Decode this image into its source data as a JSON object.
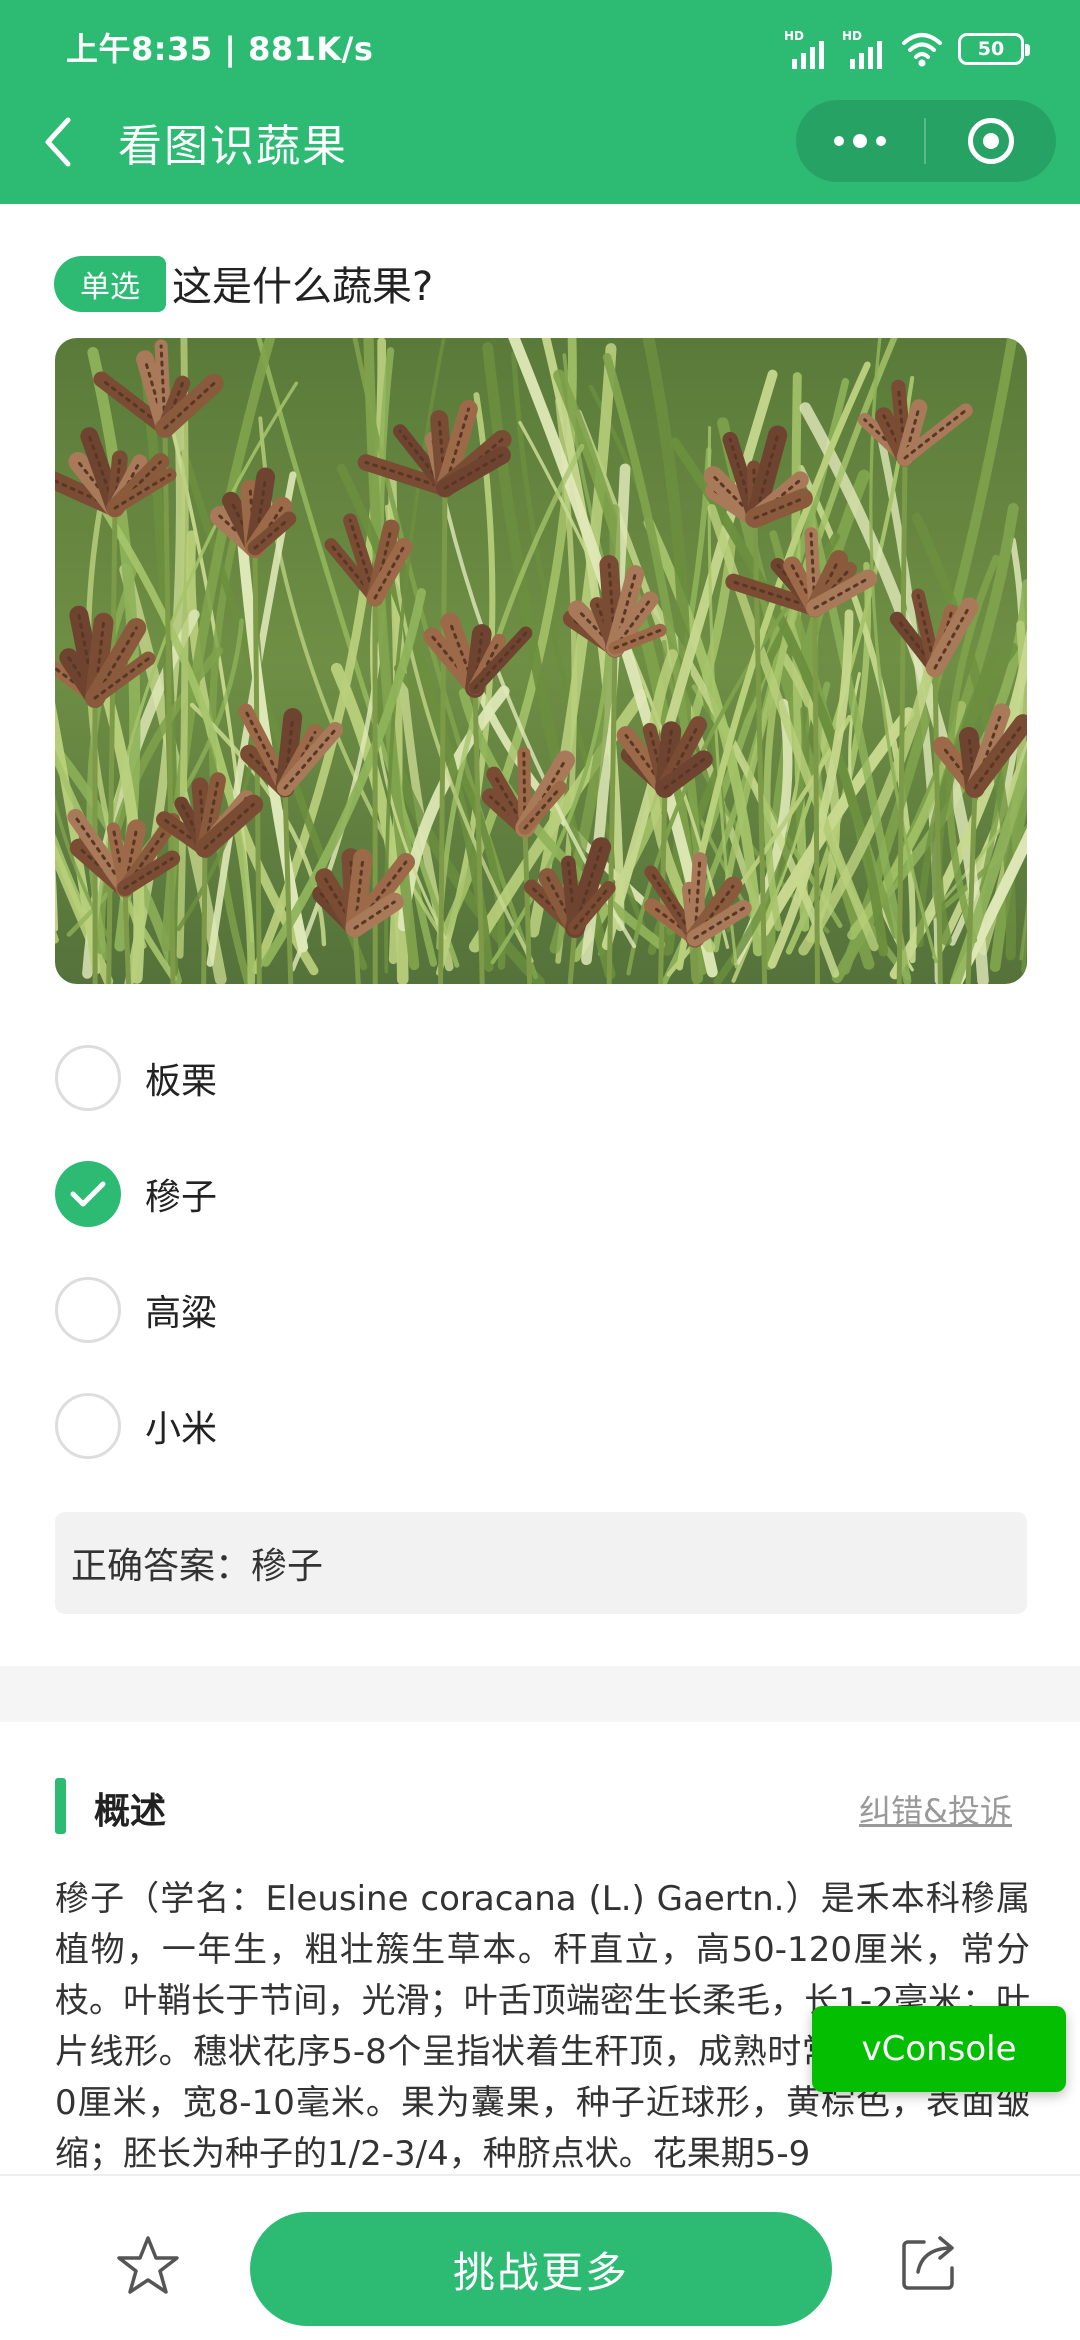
{
  "status_bar": {
    "time": "上午8:35 | 881K/s",
    "signal_1": "HD",
    "signal_2": "HD",
    "battery": "50"
  },
  "nav": {
    "title": "看图识蔬果",
    "back_icon": "chevron-left-icon",
    "more_icon": "more-dots-icon",
    "close_icon": "target-circle-icon"
  },
  "question": {
    "type_tag": "单选",
    "text": "这是什么蔬果?",
    "image_icon": "millet-field-photo"
  },
  "options": [
    {
      "label": "板栗",
      "checked": false
    },
    {
      "label": "穇子",
      "checked": true
    },
    {
      "label": "高粱",
      "checked": false
    },
    {
      "label": "小米",
      "checked": false
    }
  ],
  "answer": {
    "text": "正确答案：穇子"
  },
  "overview": {
    "title": "概述",
    "report_link": "纠错&投诉",
    "text": "穇子（学名：Eleusine coracana (L.) Gaertn.）是禾本科穇属植物，一年生，粗壮簇生草本。秆直立，高50-120厘米，常分枝。叶鞘长于节间，光滑；叶舌顶端密生长柔毛，长1-2毫米；叶片线形。穗状花序5-8个呈指状着生秆顶，成熟时常内曲，长5-10厘米，宽8-10毫米。果为囊果，种子近球形，黄棕色，表面皱缩；胚长为种子的1/2-3/4，种脐点状。花果期5-9"
  },
  "vconsole": {
    "label": "vConsole"
  },
  "bottom_bar": {
    "star_icon": "star-icon",
    "challenge_label": "挑战更多",
    "share_icon": "share-icon"
  },
  "colors": {
    "brand": "#2dbb74",
    "vconsole": "#04be02",
    "answer_bg": "#f2f2f2"
  }
}
